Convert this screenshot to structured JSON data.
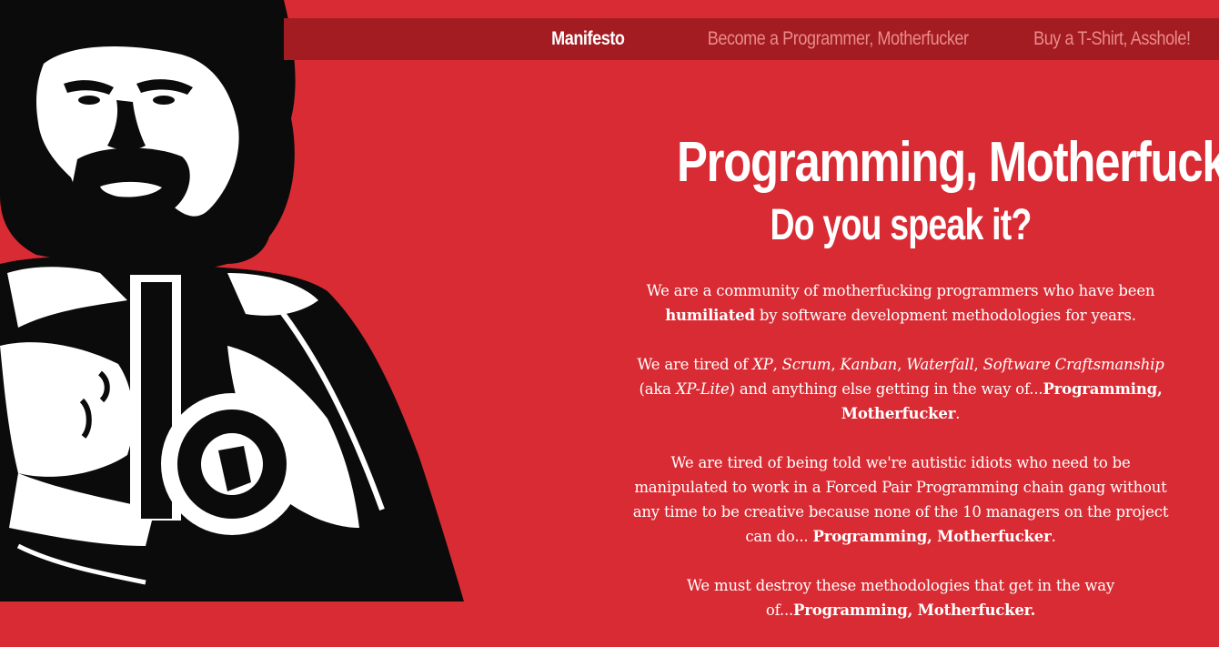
{
  "nav": {
    "items": [
      {
        "label": "Manifesto",
        "active": true
      },
      {
        "label": "Become a Programmer, Motherfucker",
        "active": false
      },
      {
        "label": "Buy a T-Shirt, Asshole!",
        "active": false
      }
    ]
  },
  "hero": {
    "title": "Programming, Motherfucker",
    "subtitle": "Do you speak it?"
  },
  "manifesto": {
    "p1": {
      "a": "We are a community of motherfucking programmers who have been ",
      "b": "humiliated",
      "c": " by software development methodologies for years."
    },
    "p2": {
      "a": "We are tired of ",
      "xp": "XP",
      "sep1": ", ",
      "scrum": "Scrum",
      "sep2": ", ",
      "kanban": "Kanban",
      "sep3": ", ",
      "waterfall": "Waterfall",
      "sep4": ", ",
      "craft": "Software Craftsmanship",
      "aka": " (aka ",
      "xplite": "XP-Lite",
      "rest": ") and anything else getting in the way of...",
      "pm": "Programming, Motherfucker",
      "end": "."
    },
    "p3": {
      "a": "We are tired of being told we're autistic idiots who need to be manipulated to work in a Forced Pair Programming chain gang without any time to be creative because none of the 10 managers on the project can do... ",
      "pm": "Programming, Motherfucker",
      "end": "."
    },
    "p4": {
      "a": "We must destroy these methodologies that get in the way of...",
      "pm": "Programming, Motherfucker."
    }
  },
  "colors": {
    "background": "#d92b33",
    "nav_bar": "#a21c22",
    "nav_active": "#ffffff",
    "nav_inactive": "#ec8a8a"
  },
  "icons": [
    "pulp-fiction-jules-illustration"
  ]
}
